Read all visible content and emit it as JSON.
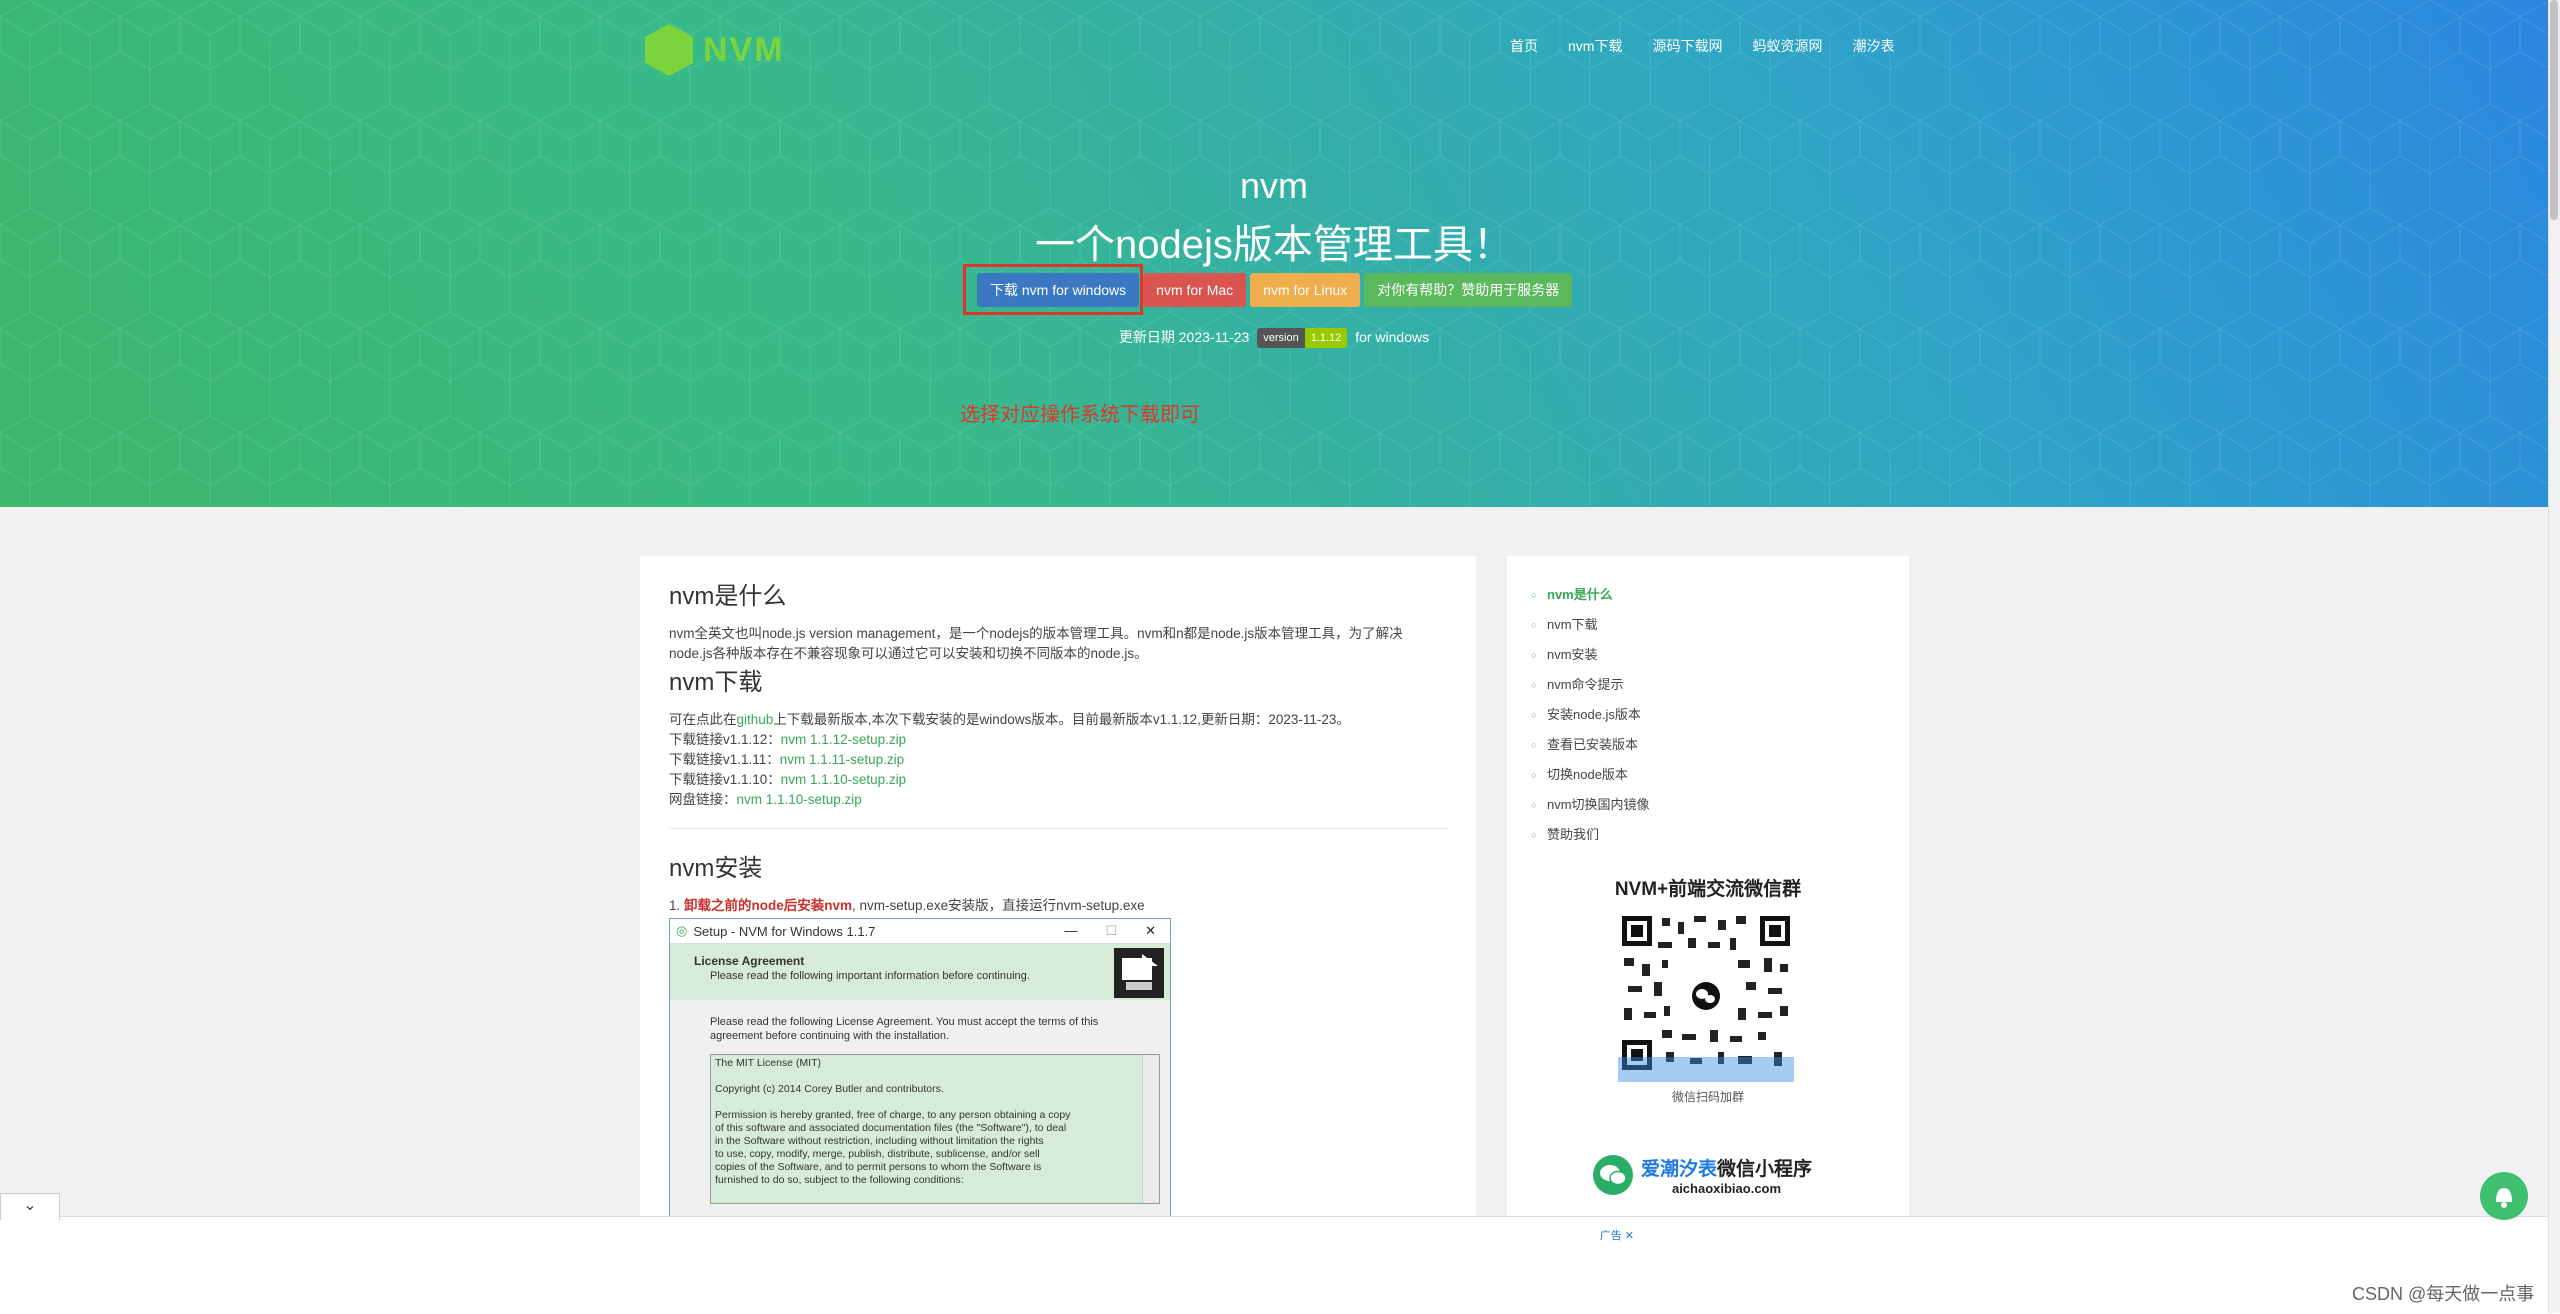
{
  "brand": {
    "logo_text": "NVM",
    "logo_color": "#7bd43b"
  },
  "nav": {
    "items": [
      "首页",
      "nvm下载",
      "源码下载网",
      "蚂蚁资源网",
      "潮汐表"
    ]
  },
  "hero": {
    "title": "nvm",
    "subtitle": "一个nodejs版本管理工具！",
    "buttons": [
      {
        "label": "下载 nvm for windows",
        "color": "#3a78c2"
      },
      {
        "label": "nvm for Mac",
        "color": "#d9534f"
      },
      {
        "label": "nvm for Linux",
        "color": "#f0ad4e"
      },
      {
        "label": "对你有帮助？赞助用于服务器",
        "color": "#5cb85c"
      }
    ],
    "update_prefix": "更新日期 2023-11-23",
    "badge_key": "version",
    "badge_value": "1.1.12",
    "update_suffix": "for windows",
    "annotation": "选择对应操作系统下载即可"
  },
  "article": {
    "sec1_title": "nvm是什么",
    "sec1_text_1": "nvm全英文也叫node.js version management，是一个nodejs的版本管理工具。nvm和n都是node.js版本管理工具，为了解决",
    "sec1_text_2": "node.js各种版本存在不兼容现象可以通过它可以安装和切换不同版本的node.js。",
    "sec2_title": "nvm下载",
    "sec2_intro_a": "可在点此在",
    "sec2_intro_link": "github",
    "sec2_intro_b": "上下载最新版本,本次下载安装的是windows版本。目前最新版本v1.1.12,更新日期：2023-11-23。",
    "downloads": [
      {
        "label": "下载链接v1.1.12：",
        "link": "nvm 1.1.12-setup.zip"
      },
      {
        "label": "下载链接v1.1.11：",
        "link": "nvm 1.1.11-setup.zip"
      },
      {
        "label": "下载链接v1.1.10：",
        "link": "nvm 1.1.10-setup.zip"
      },
      {
        "label": "网盘链接：",
        "link": "nvm 1.1.10-setup.zip"
      }
    ],
    "sec3_title": "nvm安装",
    "step1_num": "1. ",
    "step1_strong": "卸载之前的node后安装nvm",
    "step1_rest": ", nvm-setup.exe安装版，直接运行nvm-setup.exe"
  },
  "setup_window": {
    "title": "Setup - NVM for Windows 1.1.7",
    "controls": [
      "—",
      "☐",
      "✕"
    ],
    "header_title": "License Agreement",
    "header_sub": "Please read the following important information before continuing.",
    "body_1": "Please read the following License Agreement. You must accept the terms of this",
    "body_2": "agreement before continuing with the installation.",
    "license_lines": [
      "The MIT License (MIT)",
      "",
      "Copyright (c) 2014 Corey Butler and contributors.",
      "",
      "Permission is hereby granted, free of charge, to any person obtaining a copy",
      "of this software and associated documentation files (the \"Software\"), to deal",
      "in the Software without restriction, including without limitation the rights",
      "to use, copy, modify, merge, publish, distribute, sublicense, and/or sell",
      "copies of the Software, and to permit persons to whom the Software is",
      "furnished to do so, subject to the following conditions:"
    ]
  },
  "sidebar": {
    "toc": [
      "nvm是什么",
      "nvm下载",
      "nvm安装",
      "nvm命令提示",
      "安装node.js版本",
      "查看已安装版本",
      "切换node版本",
      "nvm切换国内镜像",
      "赞助我们"
    ],
    "active_index": 0,
    "wechat_title": "NVM+前端交流微信群",
    "qr_caption": "微信扫码加群",
    "mini_title_a": "爱潮汐表",
    "mini_title_b": "微信小程序",
    "mini_domain": "aichaoxibiao.com"
  },
  "ad": {
    "label": "广告 ✕"
  },
  "watermark": "CSDN @每天做一点事",
  "icons": {
    "collapse": "chevron-down-icon",
    "chat": "chat-bubble-icon",
    "wechat": "wechat-icon"
  }
}
